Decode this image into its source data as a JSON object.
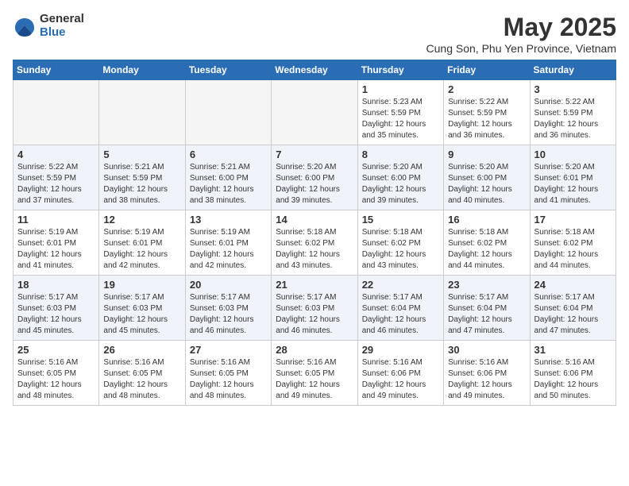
{
  "logo": {
    "general": "General",
    "blue": "Blue"
  },
  "title": "May 2025",
  "subtitle": "Cung Son, Phu Yen Province, Vietnam",
  "days_of_week": [
    "Sunday",
    "Monday",
    "Tuesday",
    "Wednesday",
    "Thursday",
    "Friday",
    "Saturday"
  ],
  "weeks": [
    [
      {
        "day": "",
        "info": ""
      },
      {
        "day": "",
        "info": ""
      },
      {
        "day": "",
        "info": ""
      },
      {
        "day": "",
        "info": ""
      },
      {
        "day": "1",
        "info": "Sunrise: 5:23 AM\nSunset: 5:59 PM\nDaylight: 12 hours\nand 35 minutes."
      },
      {
        "day": "2",
        "info": "Sunrise: 5:22 AM\nSunset: 5:59 PM\nDaylight: 12 hours\nand 36 minutes."
      },
      {
        "day": "3",
        "info": "Sunrise: 5:22 AM\nSunset: 5:59 PM\nDaylight: 12 hours\nand 36 minutes."
      }
    ],
    [
      {
        "day": "4",
        "info": "Sunrise: 5:22 AM\nSunset: 5:59 PM\nDaylight: 12 hours\nand 37 minutes."
      },
      {
        "day": "5",
        "info": "Sunrise: 5:21 AM\nSunset: 5:59 PM\nDaylight: 12 hours\nand 38 minutes."
      },
      {
        "day": "6",
        "info": "Sunrise: 5:21 AM\nSunset: 6:00 PM\nDaylight: 12 hours\nand 38 minutes."
      },
      {
        "day": "7",
        "info": "Sunrise: 5:20 AM\nSunset: 6:00 PM\nDaylight: 12 hours\nand 39 minutes."
      },
      {
        "day": "8",
        "info": "Sunrise: 5:20 AM\nSunset: 6:00 PM\nDaylight: 12 hours\nand 39 minutes."
      },
      {
        "day": "9",
        "info": "Sunrise: 5:20 AM\nSunset: 6:00 PM\nDaylight: 12 hours\nand 40 minutes."
      },
      {
        "day": "10",
        "info": "Sunrise: 5:20 AM\nSunset: 6:01 PM\nDaylight: 12 hours\nand 41 minutes."
      }
    ],
    [
      {
        "day": "11",
        "info": "Sunrise: 5:19 AM\nSunset: 6:01 PM\nDaylight: 12 hours\nand 41 minutes."
      },
      {
        "day": "12",
        "info": "Sunrise: 5:19 AM\nSunset: 6:01 PM\nDaylight: 12 hours\nand 42 minutes."
      },
      {
        "day": "13",
        "info": "Sunrise: 5:19 AM\nSunset: 6:01 PM\nDaylight: 12 hours\nand 42 minutes."
      },
      {
        "day": "14",
        "info": "Sunrise: 5:18 AM\nSunset: 6:02 PM\nDaylight: 12 hours\nand 43 minutes."
      },
      {
        "day": "15",
        "info": "Sunrise: 5:18 AM\nSunset: 6:02 PM\nDaylight: 12 hours\nand 43 minutes."
      },
      {
        "day": "16",
        "info": "Sunrise: 5:18 AM\nSunset: 6:02 PM\nDaylight: 12 hours\nand 44 minutes."
      },
      {
        "day": "17",
        "info": "Sunrise: 5:18 AM\nSunset: 6:02 PM\nDaylight: 12 hours\nand 44 minutes."
      }
    ],
    [
      {
        "day": "18",
        "info": "Sunrise: 5:17 AM\nSunset: 6:03 PM\nDaylight: 12 hours\nand 45 minutes."
      },
      {
        "day": "19",
        "info": "Sunrise: 5:17 AM\nSunset: 6:03 PM\nDaylight: 12 hours\nand 45 minutes."
      },
      {
        "day": "20",
        "info": "Sunrise: 5:17 AM\nSunset: 6:03 PM\nDaylight: 12 hours\nand 46 minutes."
      },
      {
        "day": "21",
        "info": "Sunrise: 5:17 AM\nSunset: 6:03 PM\nDaylight: 12 hours\nand 46 minutes."
      },
      {
        "day": "22",
        "info": "Sunrise: 5:17 AM\nSunset: 6:04 PM\nDaylight: 12 hours\nand 46 minutes."
      },
      {
        "day": "23",
        "info": "Sunrise: 5:17 AM\nSunset: 6:04 PM\nDaylight: 12 hours\nand 47 minutes."
      },
      {
        "day": "24",
        "info": "Sunrise: 5:17 AM\nSunset: 6:04 PM\nDaylight: 12 hours\nand 47 minutes."
      }
    ],
    [
      {
        "day": "25",
        "info": "Sunrise: 5:16 AM\nSunset: 6:05 PM\nDaylight: 12 hours\nand 48 minutes."
      },
      {
        "day": "26",
        "info": "Sunrise: 5:16 AM\nSunset: 6:05 PM\nDaylight: 12 hours\nand 48 minutes."
      },
      {
        "day": "27",
        "info": "Sunrise: 5:16 AM\nSunset: 6:05 PM\nDaylight: 12 hours\nand 48 minutes."
      },
      {
        "day": "28",
        "info": "Sunrise: 5:16 AM\nSunset: 6:05 PM\nDaylight: 12 hours\nand 49 minutes."
      },
      {
        "day": "29",
        "info": "Sunrise: 5:16 AM\nSunset: 6:06 PM\nDaylight: 12 hours\nand 49 minutes."
      },
      {
        "day": "30",
        "info": "Sunrise: 5:16 AM\nSunset: 6:06 PM\nDaylight: 12 hours\nand 49 minutes."
      },
      {
        "day": "31",
        "info": "Sunrise: 5:16 AM\nSunset: 6:06 PM\nDaylight: 12 hours\nand 50 minutes."
      }
    ]
  ]
}
